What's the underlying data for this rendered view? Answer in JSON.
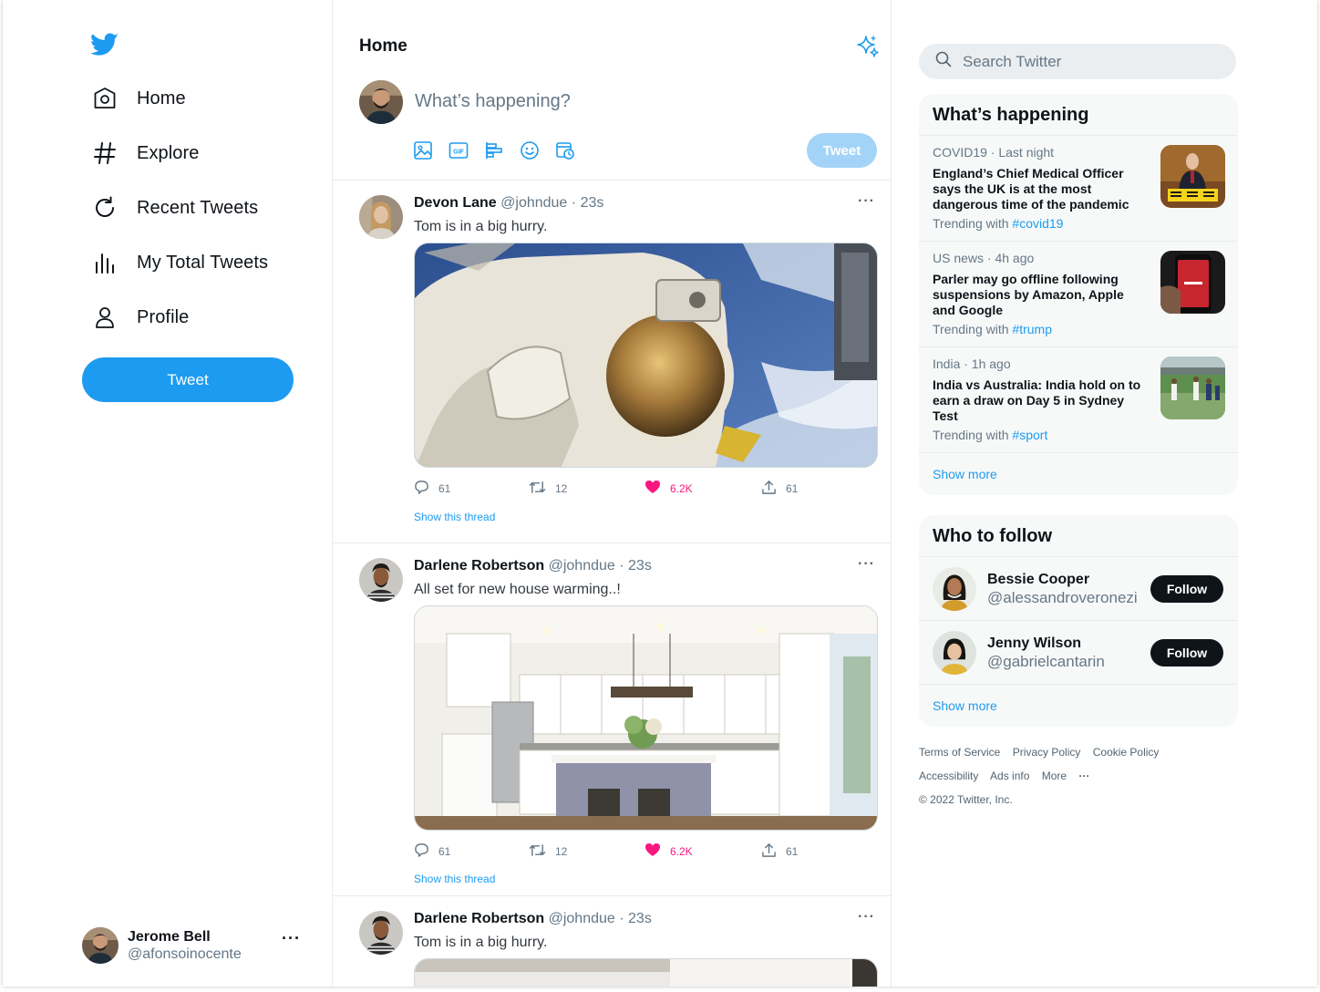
{
  "colors": {
    "accent": "#1d9bf0",
    "like": "#f91880",
    "text": "#0f1419",
    "muted": "#657786"
  },
  "sidebar": {
    "logo": "twitter-bird-icon",
    "nav": [
      {
        "label": "Home",
        "icon": "home-icon"
      },
      {
        "label": "Explore",
        "icon": "hashtag-icon"
      },
      {
        "label": "Recent Tweets",
        "icon": "refresh-icon"
      },
      {
        "label": "My Total Tweets",
        "icon": "bar-chart-icon"
      },
      {
        "label": "Profile",
        "icon": "person-icon"
      }
    ],
    "tweet_button": "Tweet",
    "account": {
      "name": "Jerome Bell",
      "handle": "@afonsoinocente",
      "more": "···"
    }
  },
  "main": {
    "title": "Home",
    "composer": {
      "placeholder": "What’s happening?",
      "tweet_button": "Tweet"
    },
    "tweets": [
      {
        "name": "Devon Lane",
        "handle": "@johndue",
        "time": "23s",
        "text": "Tom is in a big hurry.",
        "media": "astronaut photo",
        "replies": "61",
        "retweets": "12",
        "likes": "6.2K",
        "shares": "61",
        "thread": "Show this thread"
      },
      {
        "name": "Darlene Robertson",
        "handle": "@johndue",
        "time": "23s",
        "text": "All set for new house warming..!",
        "media": "kitchen photo",
        "replies": "61",
        "retweets": "12",
        "likes": "6.2K",
        "shares": "61",
        "thread": "Show this thread"
      },
      {
        "name": "Darlene Robertson",
        "handle": "@johndue",
        "time": "23s",
        "text": "Tom is in a big hurry.",
        "media": "interior photo"
      }
    ]
  },
  "right": {
    "search_placeholder": "Search Twitter",
    "happening": {
      "title": "What’s happening",
      "trends": [
        {
          "category": "COVID19 · Last night",
          "headline": "England’s Chief Medical Officer says the UK is at the most dangerous time of the pandemic",
          "with_label": "Trending with",
          "tag": "#covid19"
        },
        {
          "category": "US news · 4h ago",
          "headline": "Parler may go offline following suspensions by Amazon, Apple and Google",
          "with_label": "Trending with",
          "tag": "#trump"
        },
        {
          "category": "India · 1h ago",
          "headline": "India vs Australia: India hold on to earn a draw on Day 5 in Sydney Test",
          "with_label": "Trending with",
          "tag": "#sport"
        }
      ],
      "show_more": "Show more"
    },
    "who_to_follow": {
      "title": "Who to follow",
      "people": [
        {
          "name": "Bessie Cooper",
          "handle": "@alessandroveronezi",
          "button": "Follow"
        },
        {
          "name": "Jenny Wilson",
          "handle": "@gabrielcantarin",
          "button": "Follow"
        }
      ],
      "show_more": "Show more"
    },
    "footer": {
      "links_row1": [
        "Terms of Service",
        "Privacy Policy",
        "Cookie Policy"
      ],
      "links_row2": [
        "Accessibility",
        "Ads info",
        "More",
        "···"
      ],
      "copyright": "© 2022 Twitter, Inc."
    }
  }
}
